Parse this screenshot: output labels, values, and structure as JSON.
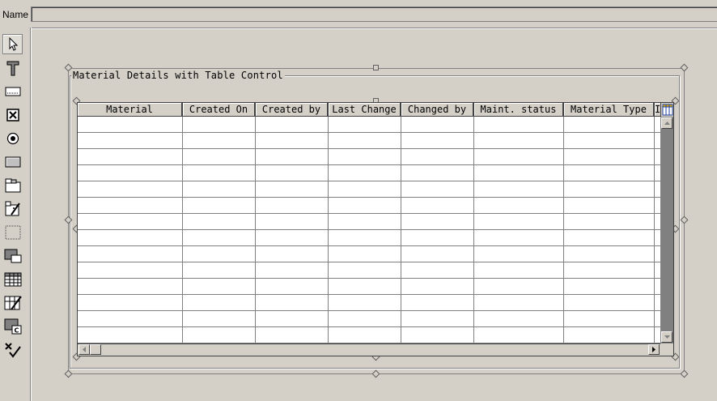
{
  "namebar": {
    "label": "Name",
    "value": ""
  },
  "palette": {
    "tools": [
      {
        "name": "pointer-tool-icon",
        "active": true
      },
      {
        "name": "text-field-tool-icon",
        "active": false
      },
      {
        "name": "input-field-tool-icon",
        "active": false
      },
      {
        "name": "checkbox-tool-icon",
        "active": false
      },
      {
        "name": "radio-button-tool-icon",
        "active": false
      },
      {
        "name": "pushbutton-tool-icon",
        "active": false
      },
      {
        "name": "tabstrip-tool-icon",
        "active": false
      },
      {
        "name": "tabstrip-wizard-tool-icon",
        "active": false
      },
      {
        "name": "box-tool-icon",
        "active": false
      },
      {
        "name": "subscreen-tool-icon",
        "active": false
      },
      {
        "name": "table-control-tool-icon",
        "active": false
      },
      {
        "name": "table-control-wizard-tool-icon",
        "active": false
      },
      {
        "name": "custom-control-tool-icon",
        "active": false
      },
      {
        "name": "status-icon-tool-icon",
        "active": false
      }
    ]
  },
  "frame": {
    "title": "Material Details with Table Control"
  },
  "table": {
    "columns": [
      "Material",
      "Created On",
      "Created by",
      "Last Change",
      "Changed by",
      "Maint. status",
      "Material Type",
      "I"
    ],
    "visible_rows": 14
  }
}
